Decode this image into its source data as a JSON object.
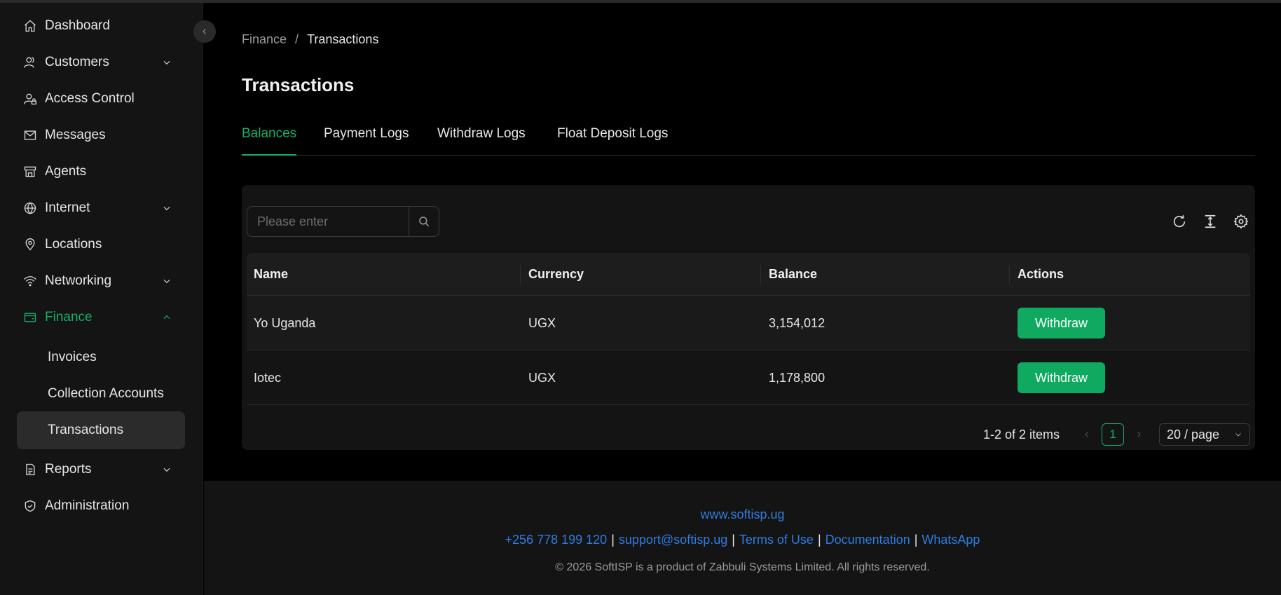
{
  "sidebar": {
    "items": [
      {
        "label": "Dashboard",
        "icon": "home-icon"
      },
      {
        "label": "Customers",
        "icon": "users-icon",
        "chevron": "down"
      },
      {
        "label": "Access Control",
        "icon": "user-lock-icon"
      },
      {
        "label": "Messages",
        "icon": "mail-icon"
      },
      {
        "label": "Agents",
        "icon": "store-icon"
      },
      {
        "label": "Internet",
        "icon": "globe-icon",
        "chevron": "down"
      },
      {
        "label": "Locations",
        "icon": "location-pin-icon"
      },
      {
        "label": "Networking",
        "icon": "wifi-icon",
        "chevron": "down"
      },
      {
        "label": "Finance",
        "icon": "wallet-icon",
        "chevron": "up",
        "active": true
      },
      {
        "label": "Reports",
        "icon": "report-icon",
        "chevron": "down"
      },
      {
        "label": "Administration",
        "icon": "shield-check-icon"
      }
    ],
    "finance_sub": [
      {
        "label": "Invoices"
      },
      {
        "label": "Collection Accounts"
      },
      {
        "label": "Transactions",
        "selected": true
      }
    ]
  },
  "breadcrumb": {
    "parent": "Finance",
    "separator": "/",
    "current": "Transactions"
  },
  "page": {
    "title": "Transactions"
  },
  "tabs": [
    {
      "label": "Balances",
      "active": true
    },
    {
      "label": "Payment Logs"
    },
    {
      "label": "Withdraw Logs"
    },
    {
      "label": "Float Deposit Logs"
    }
  ],
  "search": {
    "placeholder": "Please enter"
  },
  "table": {
    "columns": [
      "Name",
      "Currency",
      "Balance",
      "Actions"
    ],
    "rows": [
      {
        "name": "Yo Uganda",
        "currency": "UGX",
        "balance": "3,154,012",
        "action": "Withdraw"
      },
      {
        "name": "Iotec",
        "currency": "UGX",
        "balance": "1,178,800",
        "action": "Withdraw"
      }
    ]
  },
  "pagination": {
    "total": "1-2 of 2 items",
    "current_page": "1",
    "page_size": "20 / page"
  },
  "footer": {
    "website": "www.softisp.ug",
    "phone": "+256 778 199 120",
    "email": "support@softisp.ug",
    "terms": "Terms of Use",
    "docs": "Documentation",
    "whatsapp": "WhatsApp",
    "separator": "|",
    "copyright": "© 2026 SoftISP is a product of Zabbuli Systems Limited. All rights reserved."
  },
  "colors": {
    "accent": "#12b06a",
    "button": "#0fa95f",
    "link": "#2f7ce0",
    "background": "#000000",
    "panel": "#141414"
  }
}
